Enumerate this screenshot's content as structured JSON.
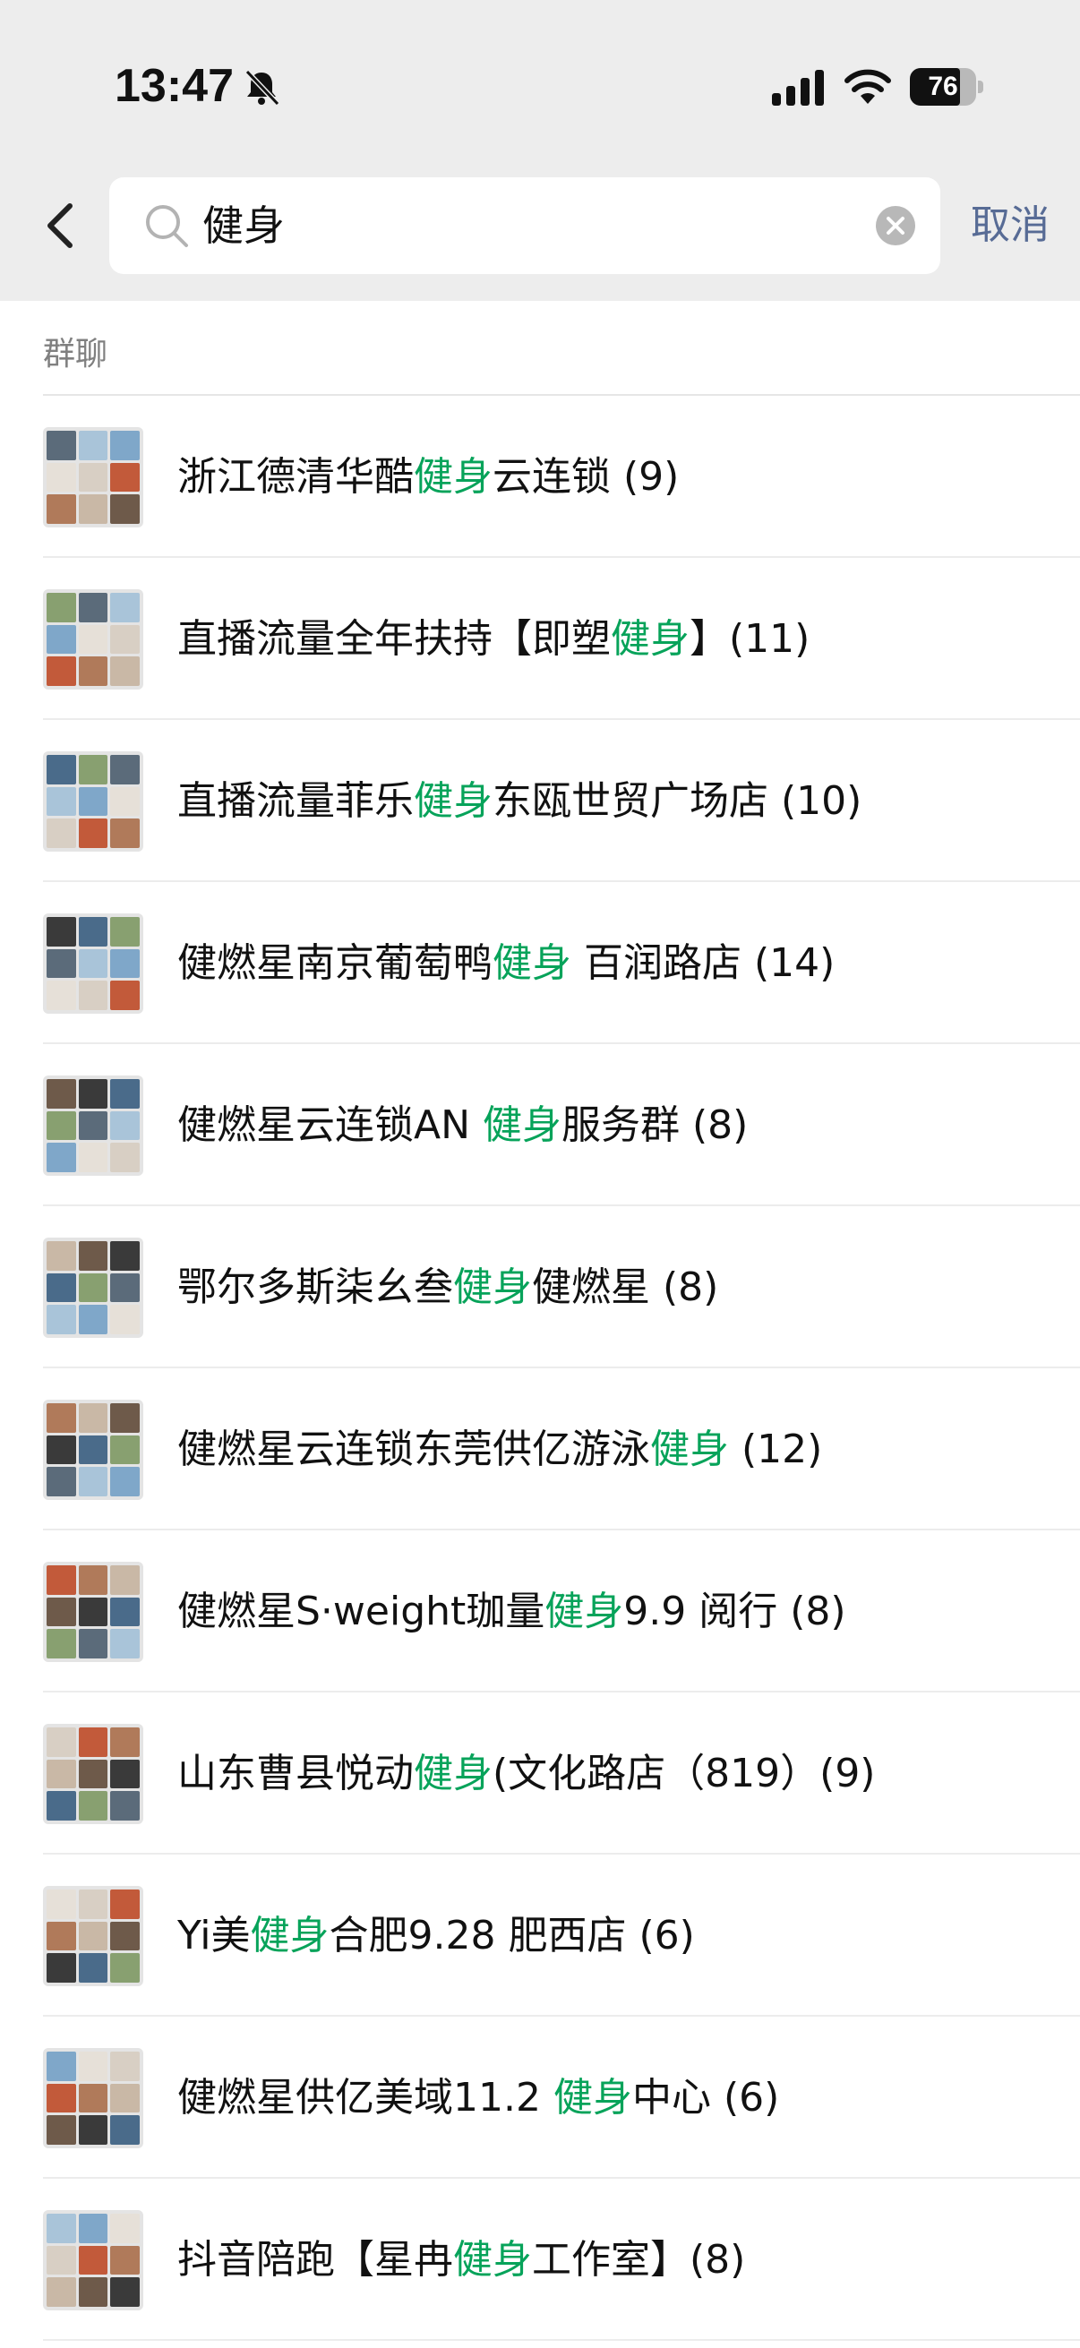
{
  "status_bar": {
    "time": "13:47",
    "battery": "76",
    "battery_level": 0.76,
    "icons": [
      "bell-muted-icon",
      "signal-icon",
      "wifi-icon",
      "battery-icon"
    ]
  },
  "search": {
    "query": "健身",
    "cancel_label": "取消"
  },
  "section": {
    "header": "群聊"
  },
  "colors": {
    "highlight": "#07a35a",
    "link": "#576b95",
    "top_bg": "#ededed"
  },
  "results": [
    {
      "before": "浙江德清华酷",
      "match": "健身",
      "after": "云连锁 (9)"
    },
    {
      "before": "直播流量全年扶持【即塑",
      "match": "健身",
      "after": "】(11)"
    },
    {
      "before": "直播流量菲乐",
      "match": "健身",
      "after": "东瓯世贸广场店 (10)"
    },
    {
      "before": "健燃星南京葡萄鸭",
      "match": "健身",
      "after": " 百润路店 (14)"
    },
    {
      "before": "健燃星云连锁AN ",
      "match": "健身",
      "after": "服务群 (8)"
    },
    {
      "before": "鄂尔多斯柒幺叁",
      "match": "健身",
      "after": "健燃星 (8)"
    },
    {
      "before": "健燃星云连锁东莞供亿游泳",
      "match": "健身",
      "after": " (12)"
    },
    {
      "before": "健燃星S·weight珈量",
      "match": "健身",
      "after": "9.9 阅行 (8)"
    },
    {
      "before": "山东曹县悦动",
      "match": "健身",
      "after": "(文化路店（819）(9)"
    },
    {
      "before": "Yi美",
      "match": "健身",
      "after": "合肥9.28 肥西店 (6)"
    },
    {
      "before": "健燃星供亿美域11.2 ",
      "match": "健身",
      "after": "中心 (6)"
    },
    {
      "before": "抖音陪跑【星冉",
      "match": "健身",
      "after": "工作室】(8)"
    }
  ]
}
